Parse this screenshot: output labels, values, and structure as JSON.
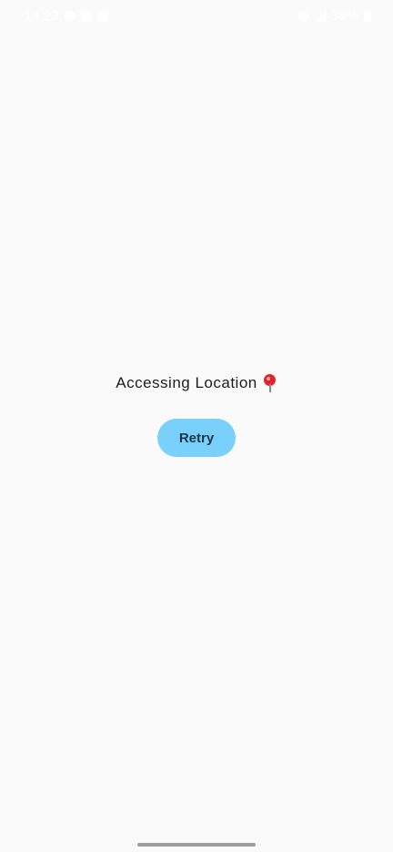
{
  "status_bar": {
    "time": "14:23",
    "battery_percent": "39%",
    "icons": [
      "settings-icon",
      "image-icon",
      "download-icon",
      "wifi-icon",
      "signal-icon",
      "battery-icon"
    ]
  },
  "main": {
    "message": "Accessing Location",
    "message_icon": "round-pushpin-icon",
    "retry_label": "Retry"
  },
  "colors": {
    "background": "#fafafa",
    "button": "#79d1fb",
    "button_text": "#16344a",
    "pin": "#e0242a"
  }
}
